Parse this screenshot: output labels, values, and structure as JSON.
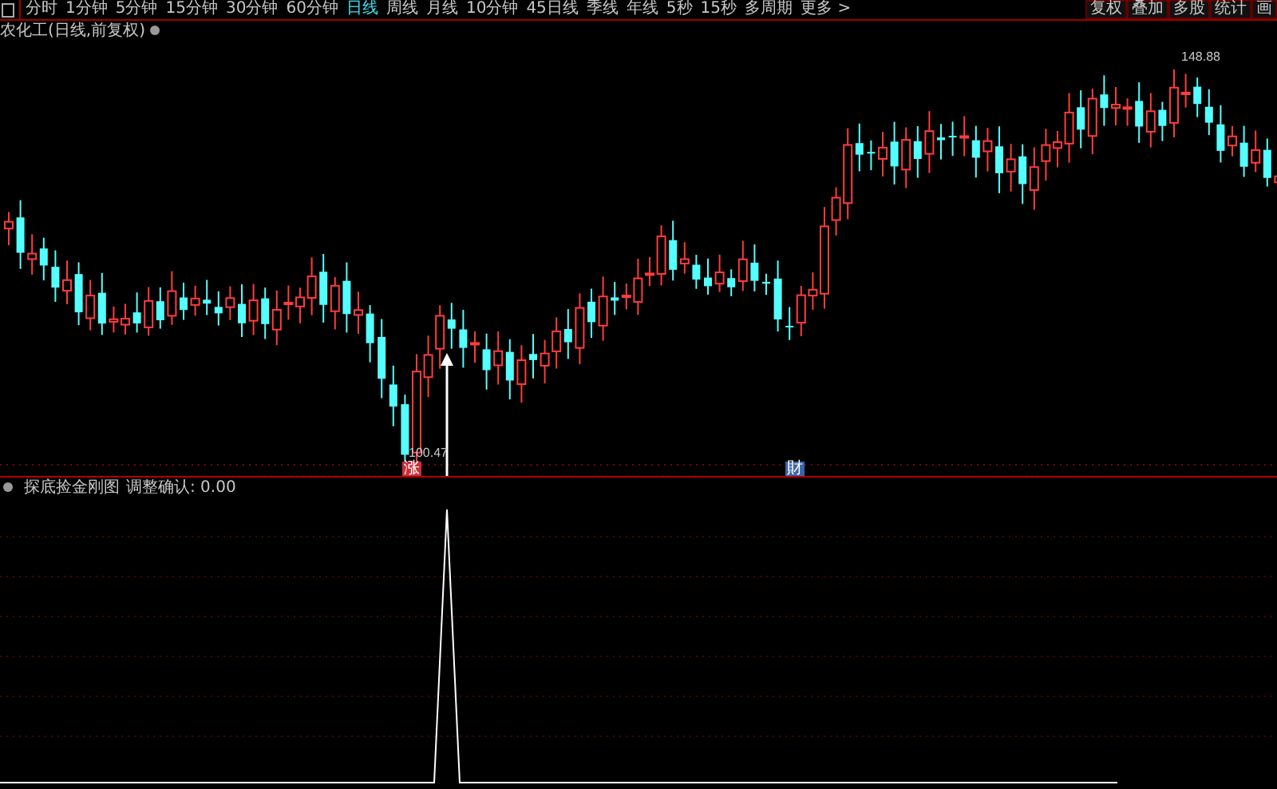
{
  "toolbar": {
    "periods": [
      {
        "label": "分时",
        "selected": false
      },
      {
        "label": "1分钟",
        "selected": false
      },
      {
        "label": "5分钟",
        "selected": false
      },
      {
        "label": "15分钟",
        "selected": false
      },
      {
        "label": "30分钟",
        "selected": false
      },
      {
        "label": "60分钟",
        "selected": false
      },
      {
        "label": "日线",
        "selected": true
      },
      {
        "label": "周线",
        "selected": false
      },
      {
        "label": "月线",
        "selected": false
      },
      {
        "label": "10分钟",
        "selected": false
      },
      {
        "label": "45日线",
        "selected": false
      },
      {
        "label": "季线",
        "selected": false
      },
      {
        "label": "年线",
        "selected": false
      },
      {
        "label": "5秒",
        "selected": false
      },
      {
        "label": "15秒",
        "selected": false
      },
      {
        "label": "多周期",
        "selected": false
      },
      {
        "label": "更多 >",
        "selected": false
      }
    ],
    "right_buttons": [
      "复权",
      "叠加",
      "多股",
      "统计",
      "画"
    ]
  },
  "main_chart": {
    "title": "农化工(日线,前复权)",
    "high_label": "148.88",
    "low_label": "100.47",
    "markers": [
      {
        "text": "涨",
        "color": "#c8303c"
      },
      {
        "text": "財",
        "color": "#3c64a8"
      }
    ]
  },
  "indicator": {
    "title": "探底捡金刚图",
    "parameter": "调整确认: 0.00"
  }
}
